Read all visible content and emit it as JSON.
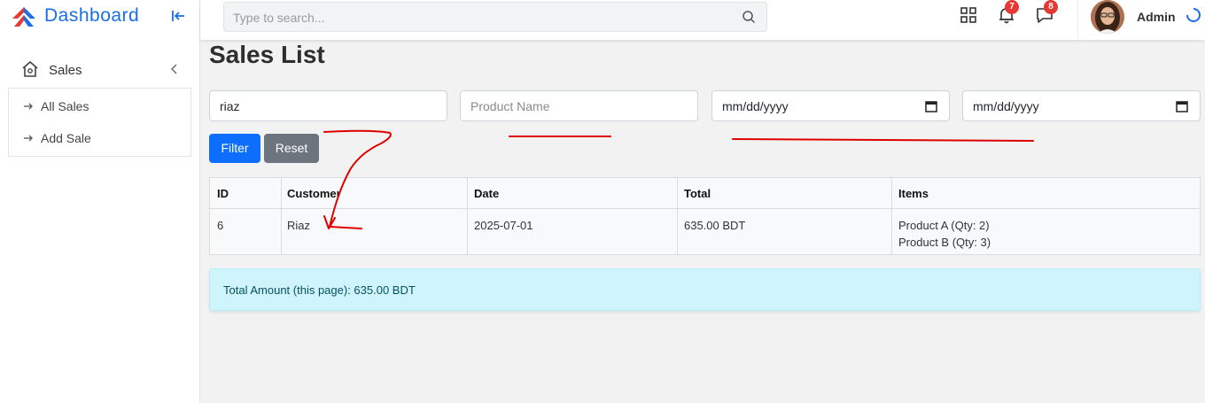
{
  "sidebar": {
    "brand": "Dashboard",
    "menu": {
      "label": "Sales"
    },
    "submenu": [
      "All Sales",
      "Add Sale"
    ]
  },
  "topbar": {
    "search_placeholder": "Type to search...",
    "notifications_count": "7",
    "messages_count": "8",
    "user_name": "Admin"
  },
  "main": {
    "title": "Sales List",
    "filters": {
      "customer_value": "riaz",
      "product_placeholder": "Product Name",
      "date_from": "mm/dd/yyyy",
      "date_to": "mm/dd/yyyy"
    },
    "buttons": {
      "filter": "Filter",
      "reset": "Reset"
    },
    "table": {
      "headers": [
        "ID",
        "Customer",
        "Date",
        "Total",
        "Items"
      ],
      "rows": [
        {
          "id": "6",
          "customer": "Riaz",
          "date": "2025-07-01",
          "total": "635.00 BDT",
          "items": [
            "Product A (Qty: 2)",
            "Product B (Qty: 3)"
          ]
        }
      ]
    },
    "total_text": "Total Amount (this page): 635.00 BDT"
  },
  "colors": {
    "brand_blue": "#1b6fe6",
    "primary": "#0d6efd",
    "secondary": "#6c757d",
    "badge_red": "#e53935",
    "info_bg": "#cff4fc",
    "annotation_red": "#e00000"
  },
  "icons": [
    "logo-icon",
    "collapse-sidebar-icon",
    "home-icon",
    "chevron-left-icon",
    "arrow-right-icon",
    "search-icon",
    "apps-grid-icon",
    "bell-icon",
    "message-icon",
    "loading-spinner-icon",
    "calendar-icon"
  ]
}
